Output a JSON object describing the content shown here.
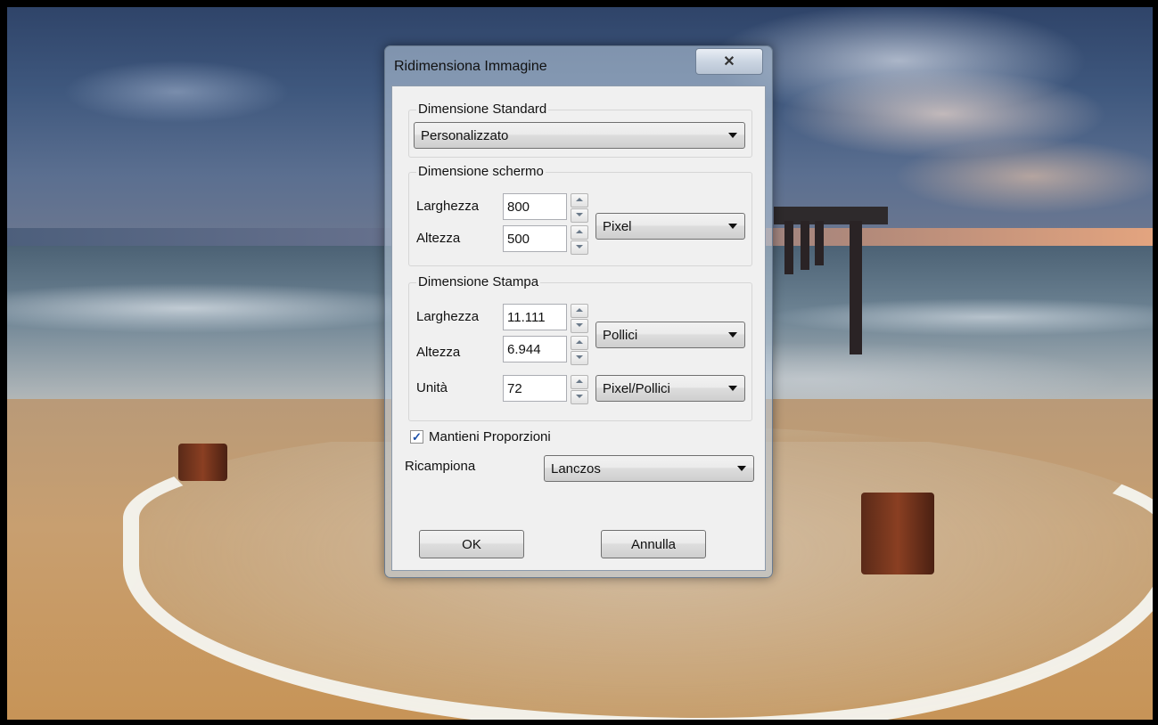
{
  "dialog": {
    "title": "Ridimensiona Immagine",
    "close_icon": "close-icon"
  },
  "standard_size": {
    "group_title": "Dimensione Standard",
    "selected": "Personalizzato"
  },
  "screen_size": {
    "group_title": "Dimensione schermo",
    "width_label": "Larghezza",
    "width_value": "800",
    "height_label": "Altezza",
    "height_value": "500",
    "unit_selected": "Pixel"
  },
  "print_size": {
    "group_title": "Dimensione Stampa",
    "width_label": "Larghezza",
    "width_value": "11.111",
    "height_label": "Altezza",
    "height_value": "6.944",
    "unit_selected": "Pollici",
    "resolution_label": "Unità",
    "resolution_value": "72",
    "resolution_unit_selected": "Pixel/Pollici"
  },
  "keep_proportions": {
    "label": "Mantieni Proporzioni",
    "checked": true
  },
  "resample": {
    "label": "Ricampiona",
    "selected": "Lanczos"
  },
  "buttons": {
    "ok": "OK",
    "cancel": "Annulla"
  }
}
